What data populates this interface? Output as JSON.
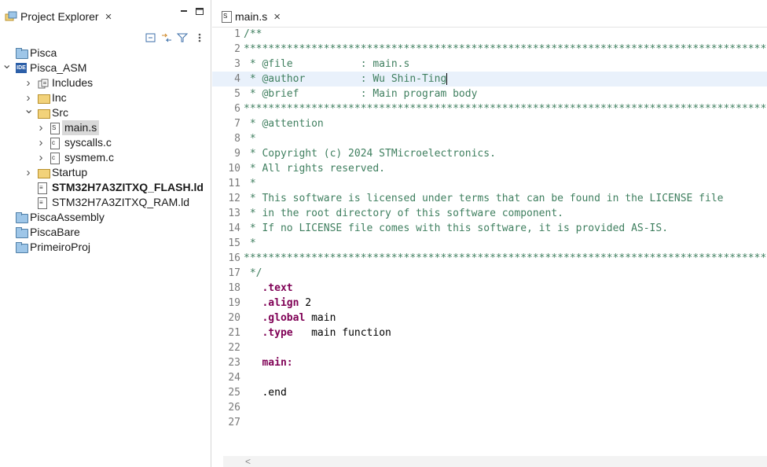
{
  "explorer": {
    "title": "Project Explorer",
    "close_glyph": "×",
    "minimize_glyph": "▬",
    "maximize_glyph": "▭",
    "toolbar_icons": [
      "collapse-all-icon",
      "link-editor-icon",
      "filter-icon",
      "view-menu-icon"
    ],
    "tree": [
      {
        "label": "Pisca",
        "icon": "folder-icon",
        "depth": 0,
        "twisty": ""
      },
      {
        "label": "Pisca_ASM",
        "icon": "ide-project-icon",
        "depth": 0,
        "twisty": "v"
      },
      {
        "label": "Includes",
        "icon": "includes-icon",
        "depth": 1,
        "twisty": ">"
      },
      {
        "label": "Inc",
        "icon": "source-folder-icon",
        "depth": 1,
        "twisty": ">"
      },
      {
        "label": "Src",
        "icon": "source-folder-icon",
        "depth": 1,
        "twisty": "v"
      },
      {
        "label": "main.s",
        "icon": "asm-file-icon",
        "depth": 2,
        "twisty": ">",
        "selected": true
      },
      {
        "label": "syscalls.c",
        "icon": "c-file-icon",
        "depth": 2,
        "twisty": ">"
      },
      {
        "label": "sysmem.c",
        "icon": "c-file-icon",
        "depth": 2,
        "twisty": ">"
      },
      {
        "label": "Startup",
        "icon": "source-folder-icon",
        "depth": 1,
        "twisty": ">"
      },
      {
        "label": "STM32H7A3ZITXQ_FLASH.ld",
        "icon": "ld-file-icon",
        "depth": 1,
        "twisty": "",
        "bold": true
      },
      {
        "label": "STM32H7A3ZITXQ_RAM.ld",
        "icon": "ld-file-icon",
        "depth": 1,
        "twisty": ""
      },
      {
        "label": "PiscaAssembly",
        "icon": "folder-icon",
        "depth": 0,
        "twisty": ""
      },
      {
        "label": "PiscaBare",
        "icon": "folder-icon",
        "depth": 0,
        "twisty": ""
      },
      {
        "label": "PrimeiroProj",
        "icon": "folder-icon",
        "depth": 0,
        "twisty": ""
      }
    ]
  },
  "editor": {
    "tab_label": "main.s",
    "tab_close": "×",
    "current_line": 4,
    "lines": [
      {
        "n": "1",
        "segments": [
          {
            "t": "/**",
            "c": "comment"
          }
        ]
      },
      {
        "n": "2",
        "segments": [
          {
            "t": "*****************************************************************************************",
            "c": "comment"
          }
        ]
      },
      {
        "n": "3",
        "segments": [
          {
            "t": " * @file           : main.s",
            "c": "comment"
          }
        ]
      },
      {
        "n": "4",
        "segments": [
          {
            "t": " * @author         : Wu Shin-Ting",
            "c": "comment"
          }
        ]
      },
      {
        "n": "5",
        "segments": [
          {
            "t": " * @brief          : Main program body",
            "c": "comment"
          }
        ]
      },
      {
        "n": "6",
        "segments": [
          {
            "t": "*****************************************************************************************",
            "c": "comment"
          }
        ]
      },
      {
        "n": "7",
        "segments": [
          {
            "t": " * @attention",
            "c": "comment"
          }
        ]
      },
      {
        "n": "8",
        "segments": [
          {
            "t": " *",
            "c": "comment"
          }
        ]
      },
      {
        "n": "9",
        "segments": [
          {
            "t": " * Copyright (c) 2024 STMicroelectronics.",
            "c": "comment"
          }
        ]
      },
      {
        "n": "10",
        "segments": [
          {
            "t": " * All rights reserved.",
            "c": "comment"
          }
        ]
      },
      {
        "n": "11",
        "segments": [
          {
            "t": " *",
            "c": "comment"
          }
        ]
      },
      {
        "n": "12",
        "segments": [
          {
            "t": " * This software is licensed under terms that can be found in the LICENSE file",
            "c": "comment"
          }
        ]
      },
      {
        "n": "13",
        "segments": [
          {
            "t": " * in the root directory of this software component.",
            "c": "comment"
          }
        ]
      },
      {
        "n": "14",
        "segments": [
          {
            "t": " * If no LICENSE file comes with this software, it is provided AS-IS.",
            "c": "comment"
          }
        ]
      },
      {
        "n": "15",
        "segments": [
          {
            "t": " *",
            "c": "comment"
          }
        ]
      },
      {
        "n": "16",
        "segments": [
          {
            "t": "*****************************************************************************************",
            "c": "comment"
          }
        ]
      },
      {
        "n": "17",
        "segments": [
          {
            "t": " */",
            "c": "comment"
          }
        ]
      },
      {
        "n": "18",
        "segments": [
          {
            "t": "   ",
            "c": "plain"
          },
          {
            "t": ".text",
            "c": "kw"
          }
        ]
      },
      {
        "n": "19",
        "segments": [
          {
            "t": "   ",
            "c": "plain"
          },
          {
            "t": ".align",
            "c": "kw"
          },
          {
            "t": " 2",
            "c": "plain"
          }
        ]
      },
      {
        "n": "20",
        "segments": [
          {
            "t": "   ",
            "c": "plain"
          },
          {
            "t": ".global",
            "c": "kw"
          },
          {
            "t": " main",
            "c": "plain"
          }
        ]
      },
      {
        "n": "21",
        "segments": [
          {
            "t": "   ",
            "c": "plain"
          },
          {
            "t": ".type",
            "c": "kw"
          },
          {
            "t": "   main function",
            "c": "plain"
          }
        ]
      },
      {
        "n": "22",
        "segments": []
      },
      {
        "n": "23",
        "segments": [
          {
            "t": "   ",
            "c": "plain"
          },
          {
            "t": "main:",
            "c": "kw"
          }
        ]
      },
      {
        "n": "24",
        "segments": []
      },
      {
        "n": "25",
        "segments": [
          {
            "t": "   .end",
            "c": "plain"
          }
        ]
      },
      {
        "n": "26",
        "segments": []
      },
      {
        "n": "27",
        "segments": []
      }
    ]
  },
  "scrollbar": {
    "left_arrow": "<"
  }
}
